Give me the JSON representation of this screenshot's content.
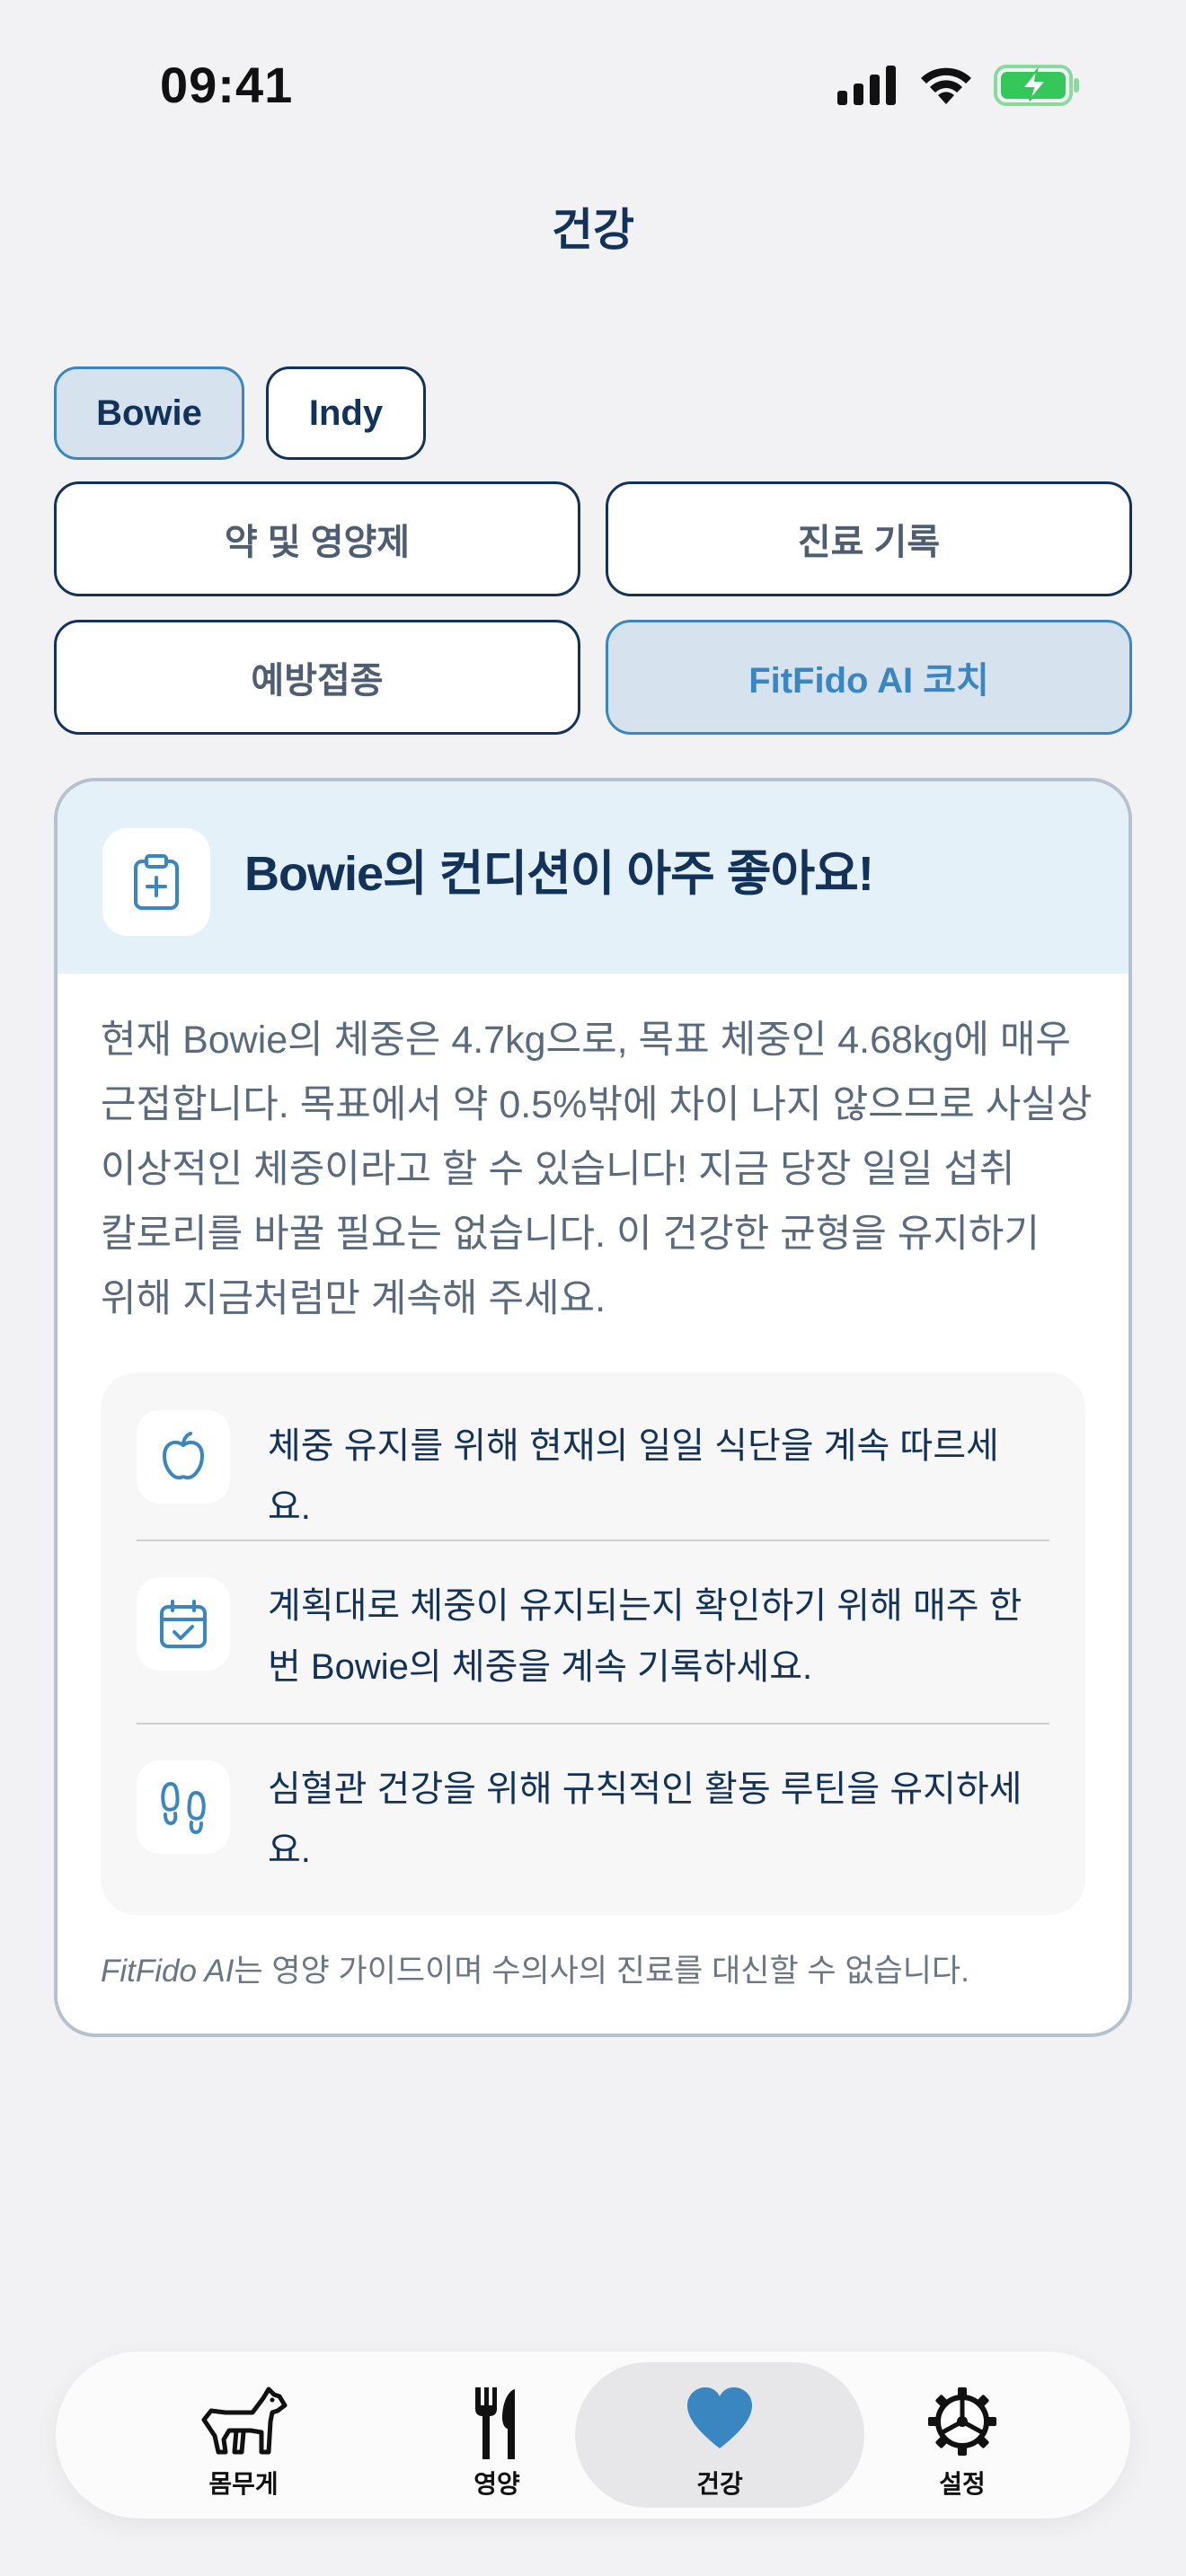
{
  "status_bar": {
    "time": "09:41"
  },
  "header": {
    "title": "건강"
  },
  "pets": [
    {
      "name": "Bowie",
      "selected": true
    },
    {
      "name": "Indy",
      "selected": false
    }
  ],
  "menu_tiles": [
    {
      "label": "약 및 영양제",
      "selected": false
    },
    {
      "label": "진료 기록",
      "selected": false
    },
    {
      "label": "예방접종",
      "selected": false
    },
    {
      "label": "FitFido AI 코치",
      "selected": true
    }
  ],
  "coach": {
    "title": "Bowie의 컨디션이 아주 좋아요!",
    "body": "현재 Bowie의 체중은 4.7kg으로, 목표 체중인 4.68kg에 매우 근접합니다. 목표에서 약 0.5%밖에 차이 나지 않으므로 사실상 이상적인 체중이라고 할 수 있습니다! 지금 당장 일일 섭취 칼로리를 바꿀 필요는 없습니다. 이 건강한 균형을 유지하기 위해 지금처럼만 계속해 주세요.",
    "tips": [
      {
        "icon": "apple-icon",
        "text": "체중 유지를 위해 현재의 일일 식단을 계속 따르세요."
      },
      {
        "icon": "calendar-check-icon",
        "text": "계획대로 체중이 유지되는지 확인하기 위해 매주 한 번 Bowie의 체중을 계속 기록하세요."
      },
      {
        "icon": "footprints-icon",
        "text": "심혈관 건강을 위해 규칙적인 활동 루틴을 유지하세요."
      }
    ],
    "disclaimer_brand": "FitFido AI",
    "disclaimer_text": "는 영양 가이드이며 수의사의 진료를 대신할 수 없습니다."
  },
  "tab_bar": {
    "tabs": [
      {
        "label": "몸무게",
        "icon": "dog-icon",
        "selected": false
      },
      {
        "label": "영양",
        "icon": "fork-knife-icon",
        "selected": false
      },
      {
        "label": "건강",
        "icon": "heart-icon",
        "selected": true
      },
      {
        "label": "설정",
        "icon": "gear-icon",
        "selected": false
      }
    ]
  },
  "colors": {
    "primary": "#13325a",
    "accent": "#3a86c0",
    "selected_bg": "#d6e3ee",
    "card_header_bg": "#e4f1f8",
    "battery": "#34c759"
  }
}
